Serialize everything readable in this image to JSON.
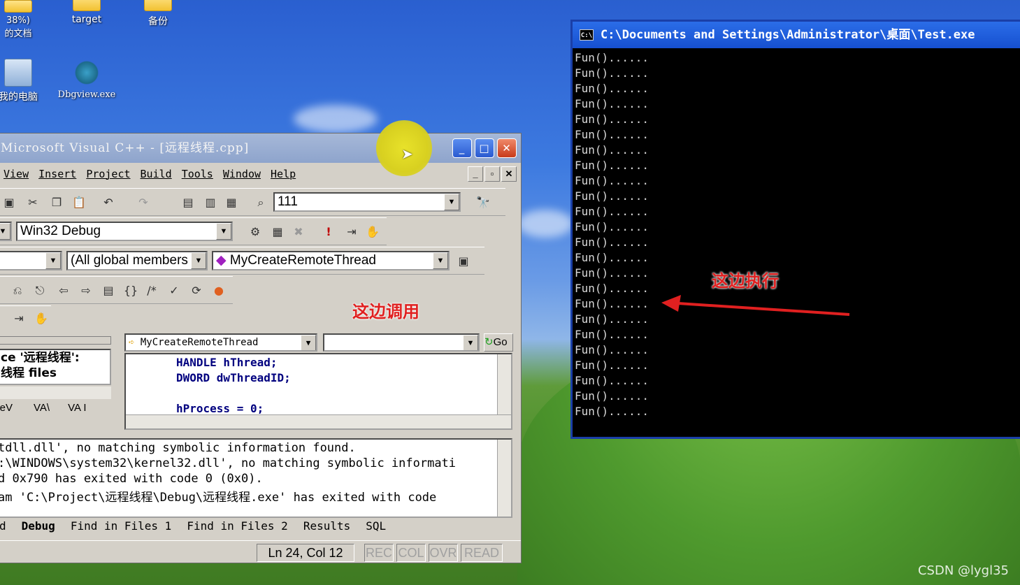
{
  "desktop": {
    "icons": [
      {
        "label": "38%)\n的文档"
      },
      {
        "label": "target"
      },
      {
        "label": "备份"
      },
      {
        "label": "我的电脑"
      },
      {
        "label": "Dbgview.exe"
      }
    ]
  },
  "vc": {
    "title": "Microsoft Visual C++ - [远程线程.cpp]",
    "menu": [
      "View",
      "Insert",
      "Project",
      "Build",
      "Tools",
      "Window",
      "Help"
    ],
    "find_combo": "111",
    "config_combo": "Win32 Debug",
    "scope_combo": "(All global members",
    "function_combo": "MyCreateRemoteThread",
    "wizard_combo": "MyCreateRemoteThread",
    "go_label": "Go",
    "left_pane_lines": [
      "ce '远程线程':",
      "线程 files"
    ],
    "left_tabs": [
      "ileV",
      "VA\\",
      "VA I"
    ],
    "code": [
      "HANDLE hThread;",
      "DWORD dwThreadID;",
      "",
      "hProcess = 0;"
    ],
    "output": [
      "tdll.dll', no matching symbolic information found.",
      ":\\WINDOWS\\system32\\kernel32.dll', no matching symbolic informati",
      "d 0x790 has exited with code 0 (0x0).",
      "am 'C:\\Project\\远程线程\\Debug\\远程线程.exe' has exited with code"
    ],
    "tabs": [
      "d",
      "Debug",
      "Find in Files 1",
      "Find in Files 2",
      "Results",
      "SQL"
    ],
    "status": {
      "position": "Ln 24, Col 12",
      "rec": "REC",
      "col": "COL",
      "ovr": "OVR",
      "read": "READ"
    }
  },
  "console": {
    "title": "C:\\Documents and Settings\\Administrator\\桌面\\Test.exe",
    "icon": "C:\\",
    "lines": [
      "Fun()......",
      "Fun()......",
      "Fun()......",
      "Fun()......",
      "Fun()......",
      "Fun()......",
      "Fun()......",
      "Fun()......",
      "Fun()......",
      "Fun()......",
      "Fun()......",
      "Fun()......",
      "Fun()......",
      "Fun()......",
      "Fun()......",
      "Fun()......",
      "Fun()......",
      "Fun()......",
      "Fun()......",
      "Fun()......",
      "Fun()......",
      "Fun()......",
      "Fun()......",
      "Fun()......"
    ]
  },
  "annotations": {
    "call_here": "这边调用",
    "exec_here": "这边执行"
  },
  "watermark": "CSDN @lygl35",
  "colors": {
    "annotation": "#e02020",
    "titlebar_active": "#1650d0"
  }
}
